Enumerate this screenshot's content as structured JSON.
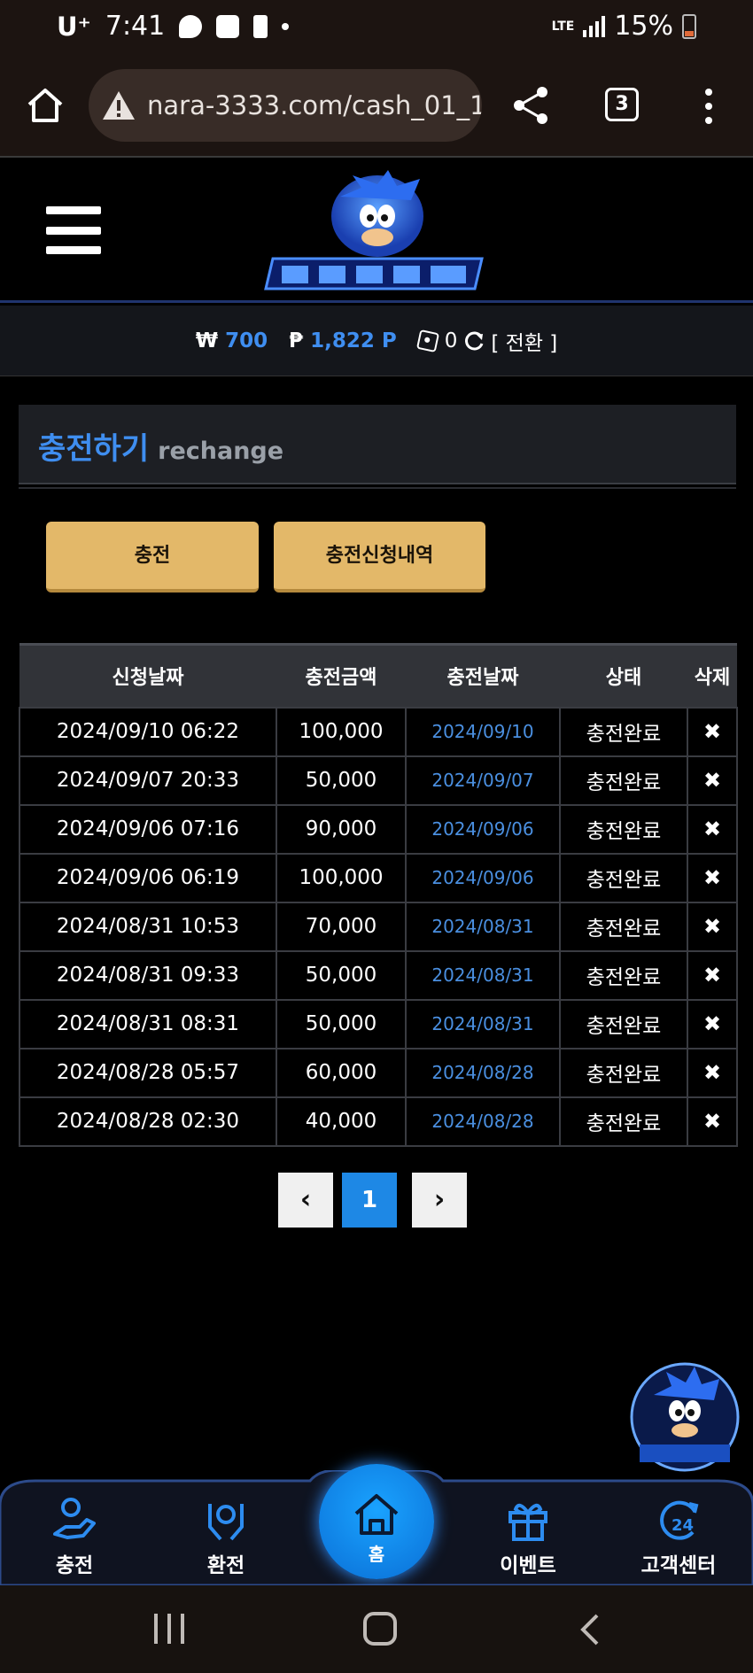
{
  "status_bar": {
    "carrier": "U⁺",
    "time": "7:41",
    "network": "LTE",
    "battery": "15%"
  },
  "browser": {
    "url": "nara-3333.com/cash_01_1.",
    "tab_count": "3"
  },
  "balance": {
    "won_symbol": "₩",
    "won_value": "700",
    "point_symbol": "₱",
    "point_value": "1,822 P",
    "chip_value": "0",
    "convert_label": "[ 전환 ]"
  },
  "section": {
    "title_ko": "충전하기",
    "title_en": "rechange"
  },
  "buttons": {
    "charge": "충전",
    "history": "충전신청내역"
  },
  "table": {
    "headers": [
      "신청날짜",
      "충전금액",
      "충전날짜",
      "상태",
      "삭제"
    ],
    "rows": [
      {
        "request_date": "2024/09/10 06:22",
        "amount": "100,000",
        "charge_date": "2024/09/10",
        "status": "충전완료",
        "delete": "✖"
      },
      {
        "request_date": "2024/09/07 20:33",
        "amount": "50,000",
        "charge_date": "2024/09/07",
        "status": "충전완료",
        "delete": "✖"
      },
      {
        "request_date": "2024/09/06 07:16",
        "amount": "90,000",
        "charge_date": "2024/09/06",
        "status": "충전완료",
        "delete": "✖"
      },
      {
        "request_date": "2024/09/06 06:19",
        "amount": "100,000",
        "charge_date": "2024/09/06",
        "status": "충전완료",
        "delete": "✖"
      },
      {
        "request_date": "2024/08/31 10:53",
        "amount": "70,000",
        "charge_date": "2024/08/31",
        "status": "충전완료",
        "delete": "✖"
      },
      {
        "request_date": "2024/08/31 09:33",
        "amount": "50,000",
        "charge_date": "2024/08/31",
        "status": "충전완료",
        "delete": "✖"
      },
      {
        "request_date": "2024/08/31 08:31",
        "amount": "50,000",
        "charge_date": "2024/08/31",
        "status": "충전완료",
        "delete": "✖"
      },
      {
        "request_date": "2024/08/28 05:57",
        "amount": "60,000",
        "charge_date": "2024/08/28",
        "status": "충전완료",
        "delete": "✖"
      },
      {
        "request_date": "2024/08/28 02:30",
        "amount": "40,000",
        "charge_date": "2024/08/28",
        "status": "충전완료",
        "delete": "✖"
      }
    ]
  },
  "pagination": {
    "prev": "‹",
    "current": "1",
    "next": "›"
  },
  "bottom_nav": {
    "charge": "충전",
    "exchange": "환전",
    "home": "홈",
    "event": "이벤트",
    "support": "고객센터"
  },
  "icons": {
    "charge": "hand-coin-icon",
    "exchange": "hands-money-icon",
    "home": "house-icon",
    "event": "gift-icon",
    "support": "24h-support-icon"
  },
  "colors": {
    "accent_blue": "#3f8ef0",
    "button_gold": "#e3b869",
    "page_bg": "#000000",
    "pager_active": "#1e88e5"
  }
}
